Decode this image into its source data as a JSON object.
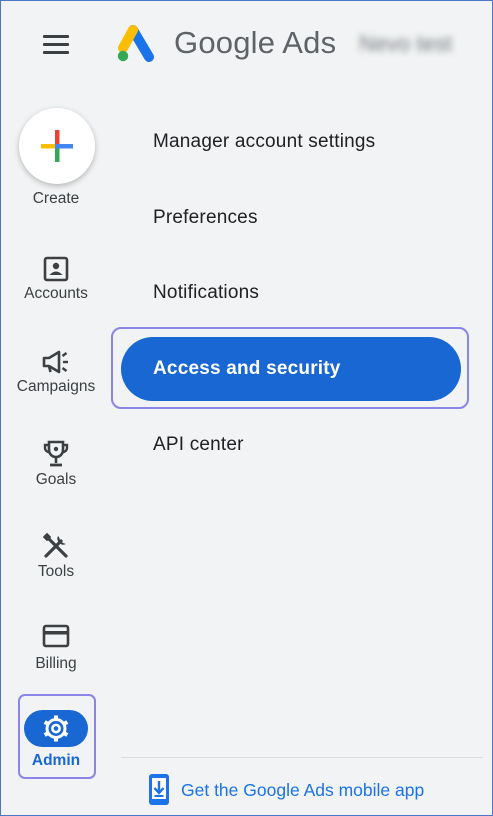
{
  "header": {
    "brand": "Google Ads",
    "account_name": "Nevo test"
  },
  "rail": {
    "create": "Create",
    "accounts": "Accounts",
    "campaigns": "Campaigns",
    "goals": "Goals",
    "tools": "Tools",
    "billing": "Billing",
    "admin": "Admin"
  },
  "menu": {
    "items": [
      "Manager account settings",
      "Preferences",
      "Notifications",
      "Access and security",
      "API center"
    ],
    "active_index": 3
  },
  "footer": {
    "mobile_app": "Get the Google Ads mobile app"
  },
  "colors": {
    "accent": "#1967d2",
    "highlight_outline": "#8a85e6",
    "background": "#f1f3f4"
  }
}
